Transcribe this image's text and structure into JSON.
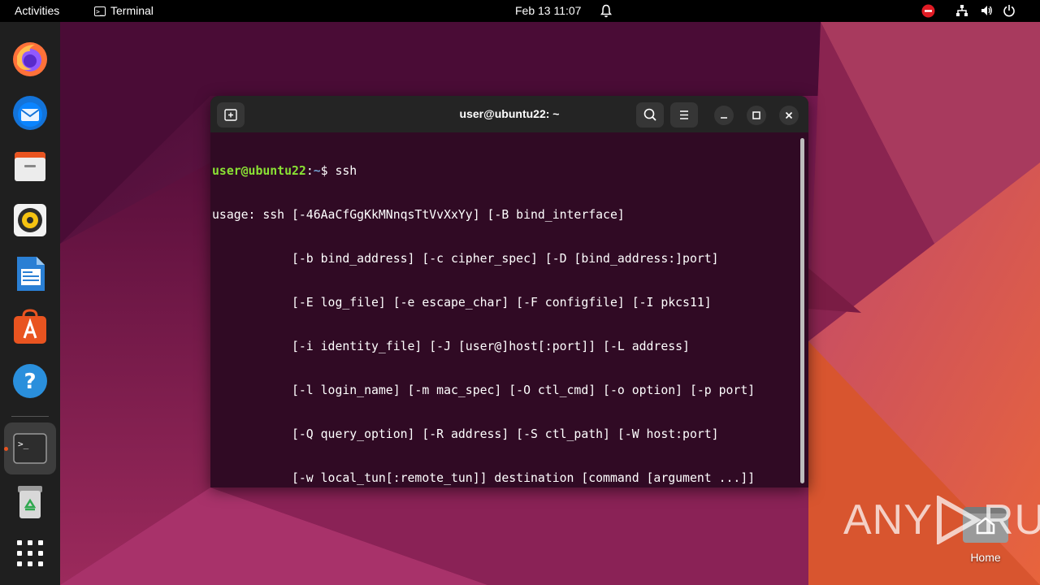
{
  "topbar": {
    "activities": "Activities",
    "app_name": "Terminal",
    "clock": "Feb 13  11:07"
  },
  "dock": {
    "items": [
      "firefox",
      "thunderbird",
      "files",
      "rhythmbox",
      "libreoffice-writer",
      "app-center",
      "help",
      "terminal",
      "trash",
      "show-apps"
    ]
  },
  "window": {
    "title": "user@ubuntu22: ~"
  },
  "terminal": {
    "prompt_user": "user@ubuntu22",
    "prompt_sep": ":",
    "prompt_path": "~",
    "prompt_sym": "$ ",
    "command": "ssh",
    "output": [
      "usage: ssh [-46AaCfGgKkMNnqsTtVvXxYy] [-B bind_interface]",
      "           [-b bind_address] [-c cipher_spec] [-D [bind_address:]port]",
      "           [-E log_file] [-e escape_char] [-F configfile] [-I pkcs11]",
      "           [-i identity_file] [-J [user@]host[:port]] [-L address]",
      "           [-l login_name] [-m mac_spec] [-O ctl_cmd] [-o option] [-p port]",
      "           [-Q query_option] [-R address] [-S ctl_path] [-W host:port]",
      "           [-w local_tun[:remote_tun]] destination [command [argument ...]]"
    ]
  },
  "desktop": {
    "home_label": "Home"
  },
  "watermark": {
    "text_left": "ANY",
    "text_right": "RUN"
  },
  "colors": {
    "terminal_bg": "#300a24",
    "prompt_green": "#8ae234",
    "accent": "#e95420"
  }
}
